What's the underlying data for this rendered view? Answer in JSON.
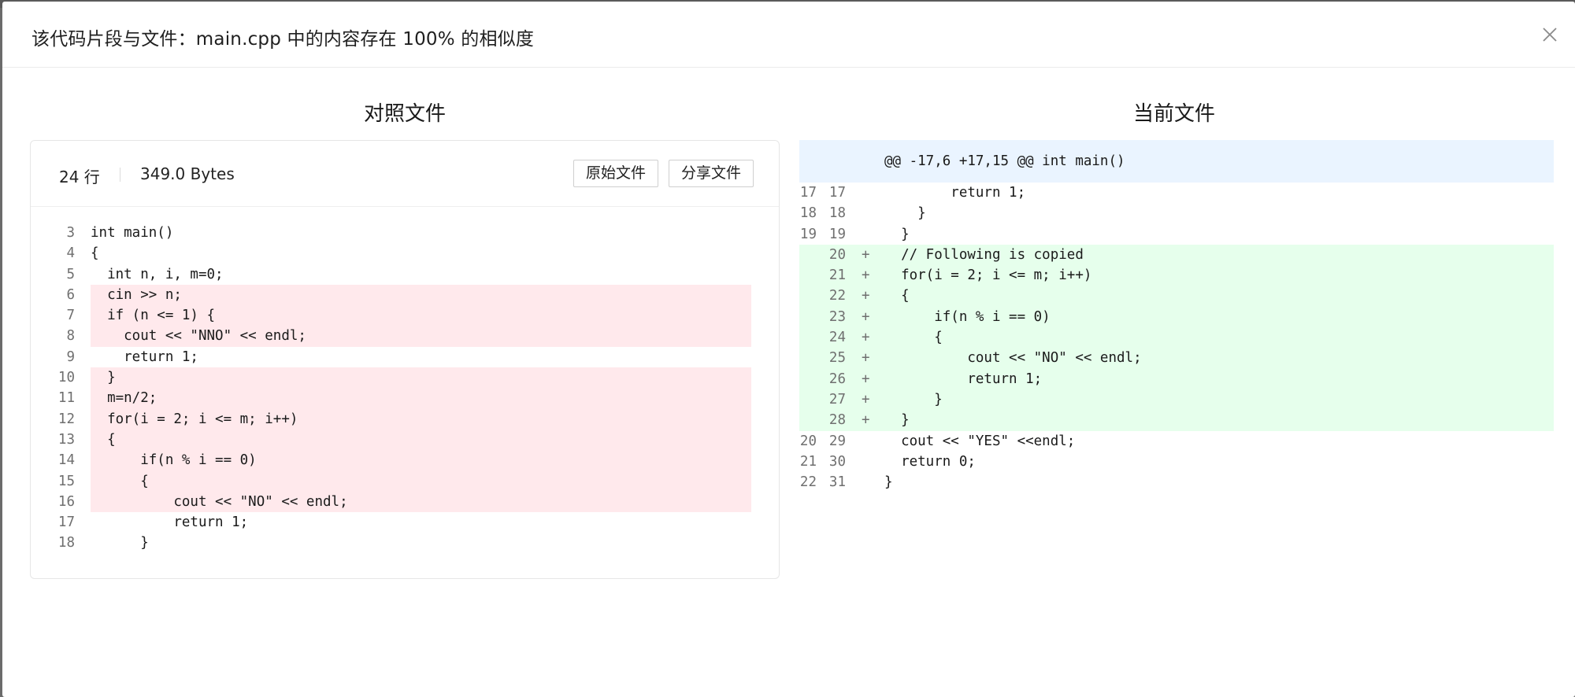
{
  "modal": {
    "title": "该代码片段与文件：main.cpp 中的内容存在 100% 的相似度",
    "close_icon": "close-icon"
  },
  "left": {
    "title": "对照文件",
    "lines_count": "24 行",
    "file_size": "349.0 Bytes",
    "raw_button": "原始文件",
    "share_button": "分享文件",
    "lines": [
      {
        "n": "3",
        "t": "int main()",
        "hl": false
      },
      {
        "n": "4",
        "t": "{",
        "hl": false
      },
      {
        "n": "5",
        "t": "  int n, i, m=0;",
        "hl": false
      },
      {
        "n": "6",
        "t": "  cin >> n;",
        "hl": true
      },
      {
        "n": "7",
        "t": "  if (n <= 1) {",
        "hl": true
      },
      {
        "n": "8",
        "t": "    cout << \"NNO\" << endl;",
        "hl": true
      },
      {
        "n": "9",
        "t": "    return 1;",
        "hl": false
      },
      {
        "n": "10",
        "t": "  }",
        "hl": true
      },
      {
        "n": "11",
        "t": "  m=n/2;",
        "hl": true
      },
      {
        "n": "12",
        "t": "  for(i = 2; i <= m; i++)",
        "hl": true
      },
      {
        "n": "13",
        "t": "  {",
        "hl": true
      },
      {
        "n": "14",
        "t": "      if(n % i == 0)",
        "hl": true
      },
      {
        "n": "15",
        "t": "      {",
        "hl": true
      },
      {
        "n": "16",
        "t": "          cout << \"NO\" << endl;",
        "hl": true
      },
      {
        "n": "17",
        "t": "          return 1;",
        "hl": false
      },
      {
        "n": "18",
        "t": "      }",
        "hl": false
      }
    ]
  },
  "right": {
    "title": "当前文件",
    "hunk": "@@ -17,6 +17,15 @@ int main()",
    "lines": [
      {
        "o": "17",
        "n": "17",
        "m": "",
        "t": "        return 1;",
        "add": false
      },
      {
        "o": "18",
        "n": "18",
        "m": "",
        "t": "    }",
        "add": false
      },
      {
        "o": "19",
        "n": "19",
        "m": "",
        "t": "  }",
        "add": false
      },
      {
        "o": "",
        "n": "20",
        "m": "+",
        "t": "  // Following is copied",
        "add": true
      },
      {
        "o": "",
        "n": "21",
        "m": "+",
        "t": "  for(i = 2; i <= m; i++)",
        "add": true
      },
      {
        "o": "",
        "n": "22",
        "m": "+",
        "t": "  {",
        "add": true
      },
      {
        "o": "",
        "n": "23",
        "m": "+",
        "t": "      if(n % i == 0)",
        "add": true
      },
      {
        "o": "",
        "n": "24",
        "m": "+",
        "t": "      {",
        "add": true
      },
      {
        "o": "",
        "n": "25",
        "m": "+",
        "t": "          cout << \"NO\" << endl;",
        "add": true
      },
      {
        "o": "",
        "n": "26",
        "m": "+",
        "t": "          return 1;",
        "add": true
      },
      {
        "o": "",
        "n": "27",
        "m": "+",
        "t": "      }",
        "add": true
      },
      {
        "o": "",
        "n": "28",
        "m": "+",
        "t": "  }",
        "add": true
      },
      {
        "o": "20",
        "n": "29",
        "m": "",
        "t": "  cout << \"YES\" <<endl;",
        "add": false
      },
      {
        "o": "21",
        "n": "30",
        "m": "",
        "t": "  return 0;",
        "add": false
      },
      {
        "o": "22",
        "n": "31",
        "m": "",
        "t": "}",
        "add": false
      }
    ]
  }
}
